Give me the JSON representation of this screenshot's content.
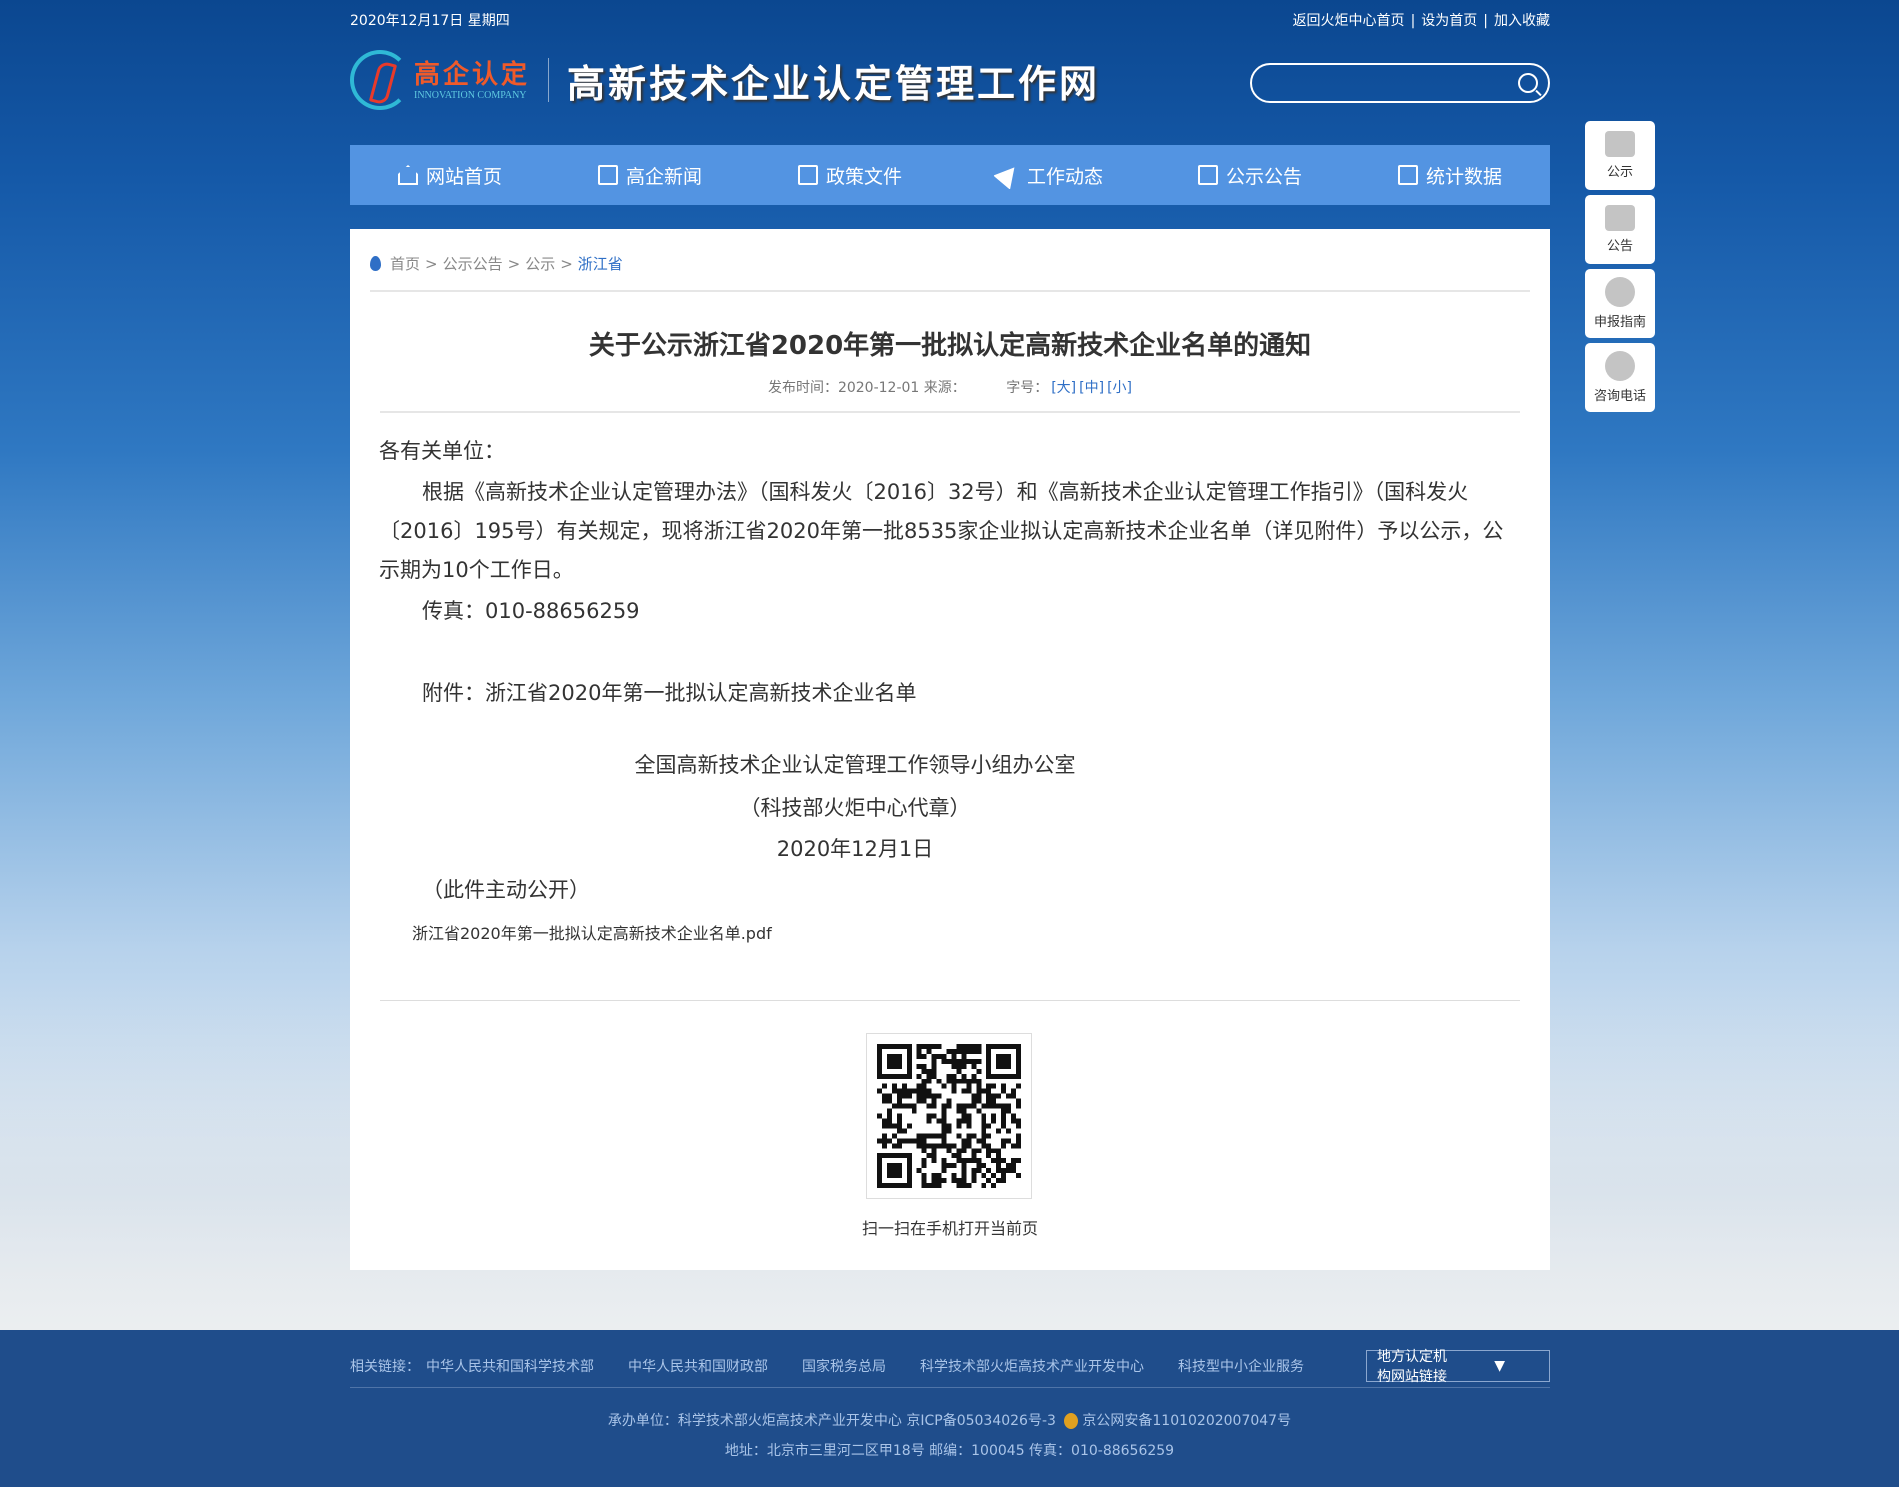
{
  "topbar": {
    "date": "2020年12月17日 星期四",
    "links": [
      "返回火炬中心首页",
      "设为首页",
      "加入收藏"
    ],
    "separator": "|"
  },
  "logo": {
    "cn": "高企认定",
    "en": "INNOVATION COMPANY"
  },
  "site_title": "高新技术企业认定管理工作网",
  "search": {
    "placeholder": "",
    "value": "",
    "icon": "search-icon"
  },
  "nav": [
    {
      "label": "网站首页",
      "icon": "home"
    },
    {
      "label": "高企新闻",
      "icon": "news"
    },
    {
      "label": "政策文件",
      "icon": "document"
    },
    {
      "label": "工作动态",
      "icon": "paper-plane"
    },
    {
      "label": "公示公告",
      "icon": "clipboard"
    },
    {
      "label": "统计数据",
      "icon": "chart"
    }
  ],
  "breadcrumb": {
    "items": [
      "首页",
      "公示公告",
      "公示"
    ],
    "current": "浙江省",
    "sep": ">"
  },
  "article": {
    "title": "关于公示浙江省2020年第一批拟认定高新技术企业名单的通知",
    "meta": "发布时间：2020-12-01 来源：",
    "font_label": "字号：",
    "font_sizes": [
      "[大]",
      "[中]",
      "[小]"
    ],
    "greeting": "各有关单位：",
    "para1": "根据《高新技术企业认定管理办法》（国科发火〔2016〕32号）和《高新技术企业认定管理工作指引》（国科发火〔2016〕195号）有关规定，现将浙江省2020年第一批8535家企业拟认定高新技术企业名单（详见附件）予以公示，公示期为10个工作日。",
    "fax": "传真：010-88656259",
    "attachment_line": "附件：浙江省2020年第一批拟认定高新技术企业名单",
    "sign_org": "全国高新技术企业认定管理工作领导小组办公室",
    "sign_seal": "（科技部火炬中心代章）",
    "sign_date": "2020年12月1日",
    "disclosure": "（此件主动公开）",
    "attachment_file": "浙江省2020年第一批拟认定高新技术企业名单.pdf"
  },
  "qr_caption": "扫一扫在手机打开当前页",
  "side": [
    {
      "label": "公示",
      "icon": "signboard"
    },
    {
      "label": "公告",
      "icon": "notepad"
    },
    {
      "label": "申报指南",
      "icon": "compass"
    },
    {
      "label": "咨询电话",
      "icon": "phone"
    }
  ],
  "footer": {
    "links_label": "相关链接：",
    "links": [
      "中华人民共和国科学技术部",
      "中华人民共和国财政部",
      "国家税务总局",
      "科学技术部火炬高技术产业开发中心",
      "科技型中小企业服务"
    ],
    "select": "地方认定机构网站链接",
    "line1a": "承办单位：科学技术部火炬高技术产业开发中心 京ICP备05034026号-3",
    "line1b": "京公网安备11010202007047号",
    "line2": "地址：北京市三里河二区甲18号 邮编：100045 传真：010-88656259"
  },
  "colors": {
    "nav": "#5394e2",
    "footer": "#1f4d8b",
    "link": "#2f6fc6"
  }
}
